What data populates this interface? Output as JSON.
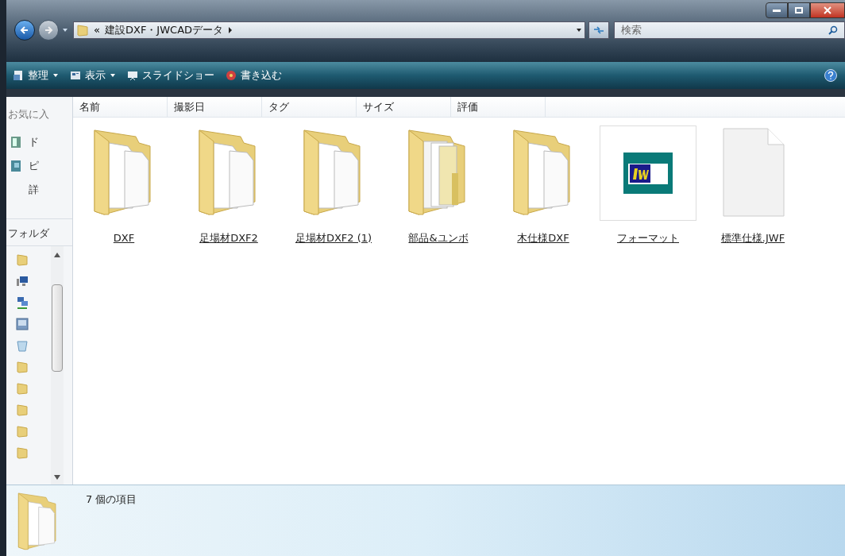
{
  "address": {
    "prefix": "«",
    "path": "建設DXF・JWCADデータ"
  },
  "search": {
    "placeholder": "検索"
  },
  "toolbar": [
    {
      "label": "整理",
      "kind": "organize",
      "dropdown": true
    },
    {
      "label": "表示",
      "kind": "views",
      "dropdown": true
    },
    {
      "label": "スライドショー",
      "kind": "slideshow",
      "dropdown": false
    },
    {
      "label": "書き込む",
      "kind": "burn",
      "dropdown": false
    }
  ],
  "navigation": {
    "favorites_header": "お気に入",
    "favorite_links": [
      {
        "label": "ド",
        "kind": "docs"
      },
      {
        "label": "ピ",
        "kind": "pictures"
      },
      {
        "label": "詳",
        "kind": "more"
      }
    ],
    "folders_header": "フォルダ",
    "tree": [
      {
        "kind": "folder"
      },
      {
        "kind": "computer"
      },
      {
        "kind": "network"
      },
      {
        "kind": "control"
      },
      {
        "kind": "recycle"
      },
      {
        "kind": "folder"
      },
      {
        "kind": "folder"
      },
      {
        "kind": "folder"
      },
      {
        "kind": "folder"
      },
      {
        "kind": "folder"
      }
    ]
  },
  "columns": [
    "名前",
    "撮影日",
    "タグ",
    "サイズ",
    "評価"
  ],
  "items": [
    {
      "name": "DXF",
      "kind": "folder"
    },
    {
      "name": "足場材DXF2",
      "kind": "folder"
    },
    {
      "name": "足場材DXF2 (1)",
      "kind": "folder"
    },
    {
      "name": "部品&ユンボ",
      "kind": "folder-docs"
    },
    {
      "name": "木仕様DXF",
      "kind": "folder"
    },
    {
      "name": "フォーマット",
      "kind": "jw"
    },
    {
      "name": "標準仕様.JWF",
      "kind": "blank"
    }
  ],
  "status": "7 個の項目"
}
